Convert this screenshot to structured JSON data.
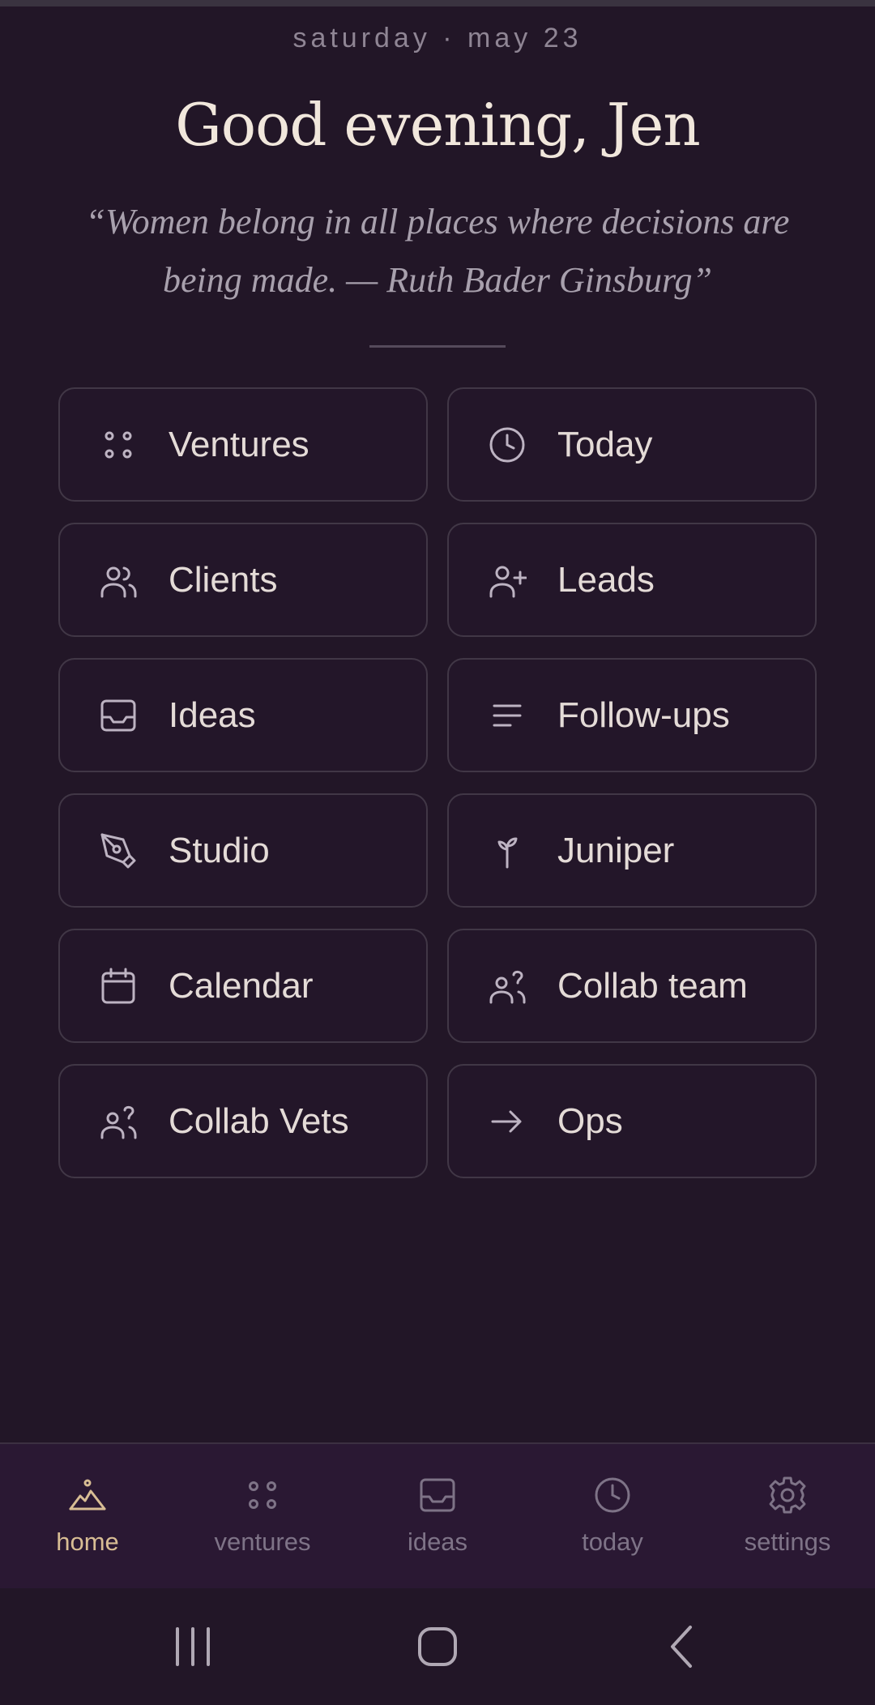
{
  "header": {
    "date": "saturday · may 23",
    "greeting": "Good evening, Jen",
    "quote": "“Women belong in all places where decisions are being made. — Ruth Bader Ginsburg”"
  },
  "tiles": [
    {
      "label": "Ventures",
      "icon": "dots-grid-icon"
    },
    {
      "label": "Today",
      "icon": "clock-icon"
    },
    {
      "label": "Clients",
      "icon": "users-icon"
    },
    {
      "label": "Leads",
      "icon": "user-plus-icon"
    },
    {
      "label": "Ideas",
      "icon": "inbox-icon"
    },
    {
      "label": "Follow-ups",
      "icon": "lines-icon"
    },
    {
      "label": "Studio",
      "icon": "pen-tool-icon"
    },
    {
      "label": "Juniper",
      "icon": "sprout-icon"
    },
    {
      "label": "Calendar",
      "icon": "calendar-icon"
    },
    {
      "label": "Collab team",
      "icon": "users-question-icon"
    },
    {
      "label": "Collab Vets",
      "icon": "users-question-icon"
    },
    {
      "label": "Ops",
      "icon": "arrow-right-icon"
    }
  ],
  "nav": [
    {
      "label": "home",
      "icon": "mountain-icon",
      "active": true
    },
    {
      "label": "ventures",
      "icon": "dots-grid-icon"
    },
    {
      "label": "ideas",
      "icon": "inbox-icon"
    },
    {
      "label": "today",
      "icon": "clock-icon"
    },
    {
      "label": "settings",
      "icon": "gear-icon"
    }
  ],
  "colors": {
    "background": "#221627",
    "accent": "#d8bd94",
    "nav_background": "#2a1833"
  }
}
